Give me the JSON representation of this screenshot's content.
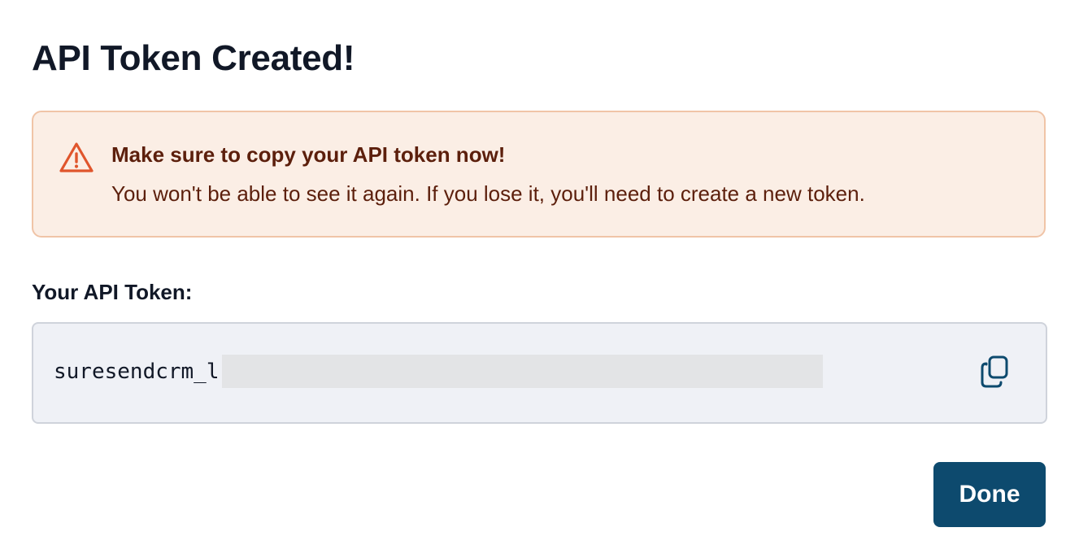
{
  "dialog": {
    "title": "API Token Created!",
    "alert": {
      "icon": "warning-triangle-icon",
      "heading": "Make sure to copy your API token now!",
      "body": "You won't be able to see it again. If you lose it, you'll need to create a new token."
    },
    "token": {
      "label": "Your API Token:",
      "value_visible": "suresendcrm_l",
      "copy_icon": "copy-icon"
    },
    "done_label": "Done"
  },
  "colors": {
    "alert_background": "#fbeee5",
    "alert_border": "#f0c4a7",
    "alert_text": "#5c1f0c",
    "alert_icon": "#e0552c",
    "token_background": "#eff1f6",
    "token_border": "#cfd3db",
    "primary_button": "#0d4a6e",
    "copy_icon": "#0d4a6e",
    "title_text": "#111827"
  }
}
